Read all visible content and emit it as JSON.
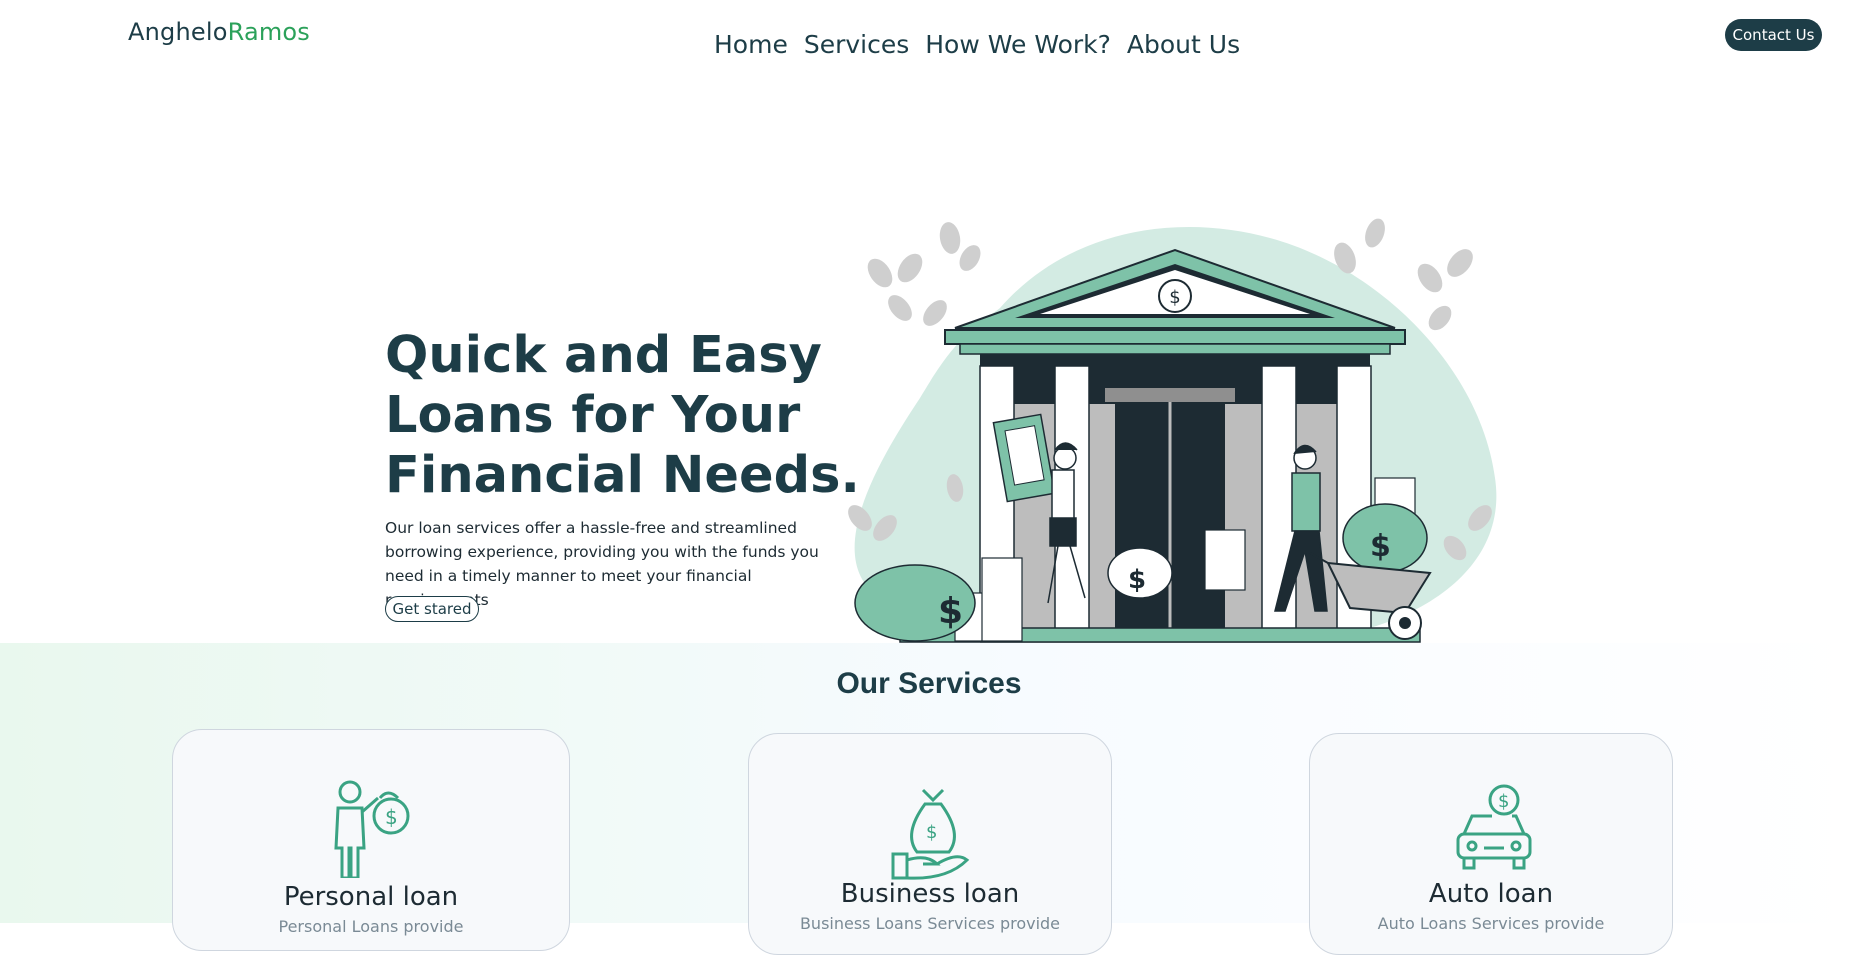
{
  "brand": {
    "first": "Anghelo",
    "second": "Ramos"
  },
  "nav": {
    "items": [
      "Home",
      "Services",
      "How We Work?",
      "About Us"
    ]
  },
  "header": {
    "contact_label": "Contact Us"
  },
  "hero": {
    "title": "Quick and Easy Loans for Your Financial Needs.",
    "text": "Our loan services offer a hassle-free and streamlined borrowing experience, providing you with the funds you need in a timely manner to meet your financial requirements",
    "cta_label": "Get stared"
  },
  "services": {
    "title": "Our Services",
    "cards": [
      {
        "title": "Personal loan",
        "desc": "Personal Loans provide",
        "icon": "person-money-bag-icon"
      },
      {
        "title": "Business loan",
        "desc": "Business Loans Services provide",
        "icon": "hand-money-bag-icon"
      },
      {
        "title": "Auto loan",
        "desc": "Auto Loans Services provide",
        "icon": "car-dollar-icon"
      }
    ]
  },
  "colors": {
    "primary": "#1d3d47",
    "accent": "#2ba15a",
    "mint": "#7ec2a8",
    "mint_light": "#d3ebe3"
  }
}
